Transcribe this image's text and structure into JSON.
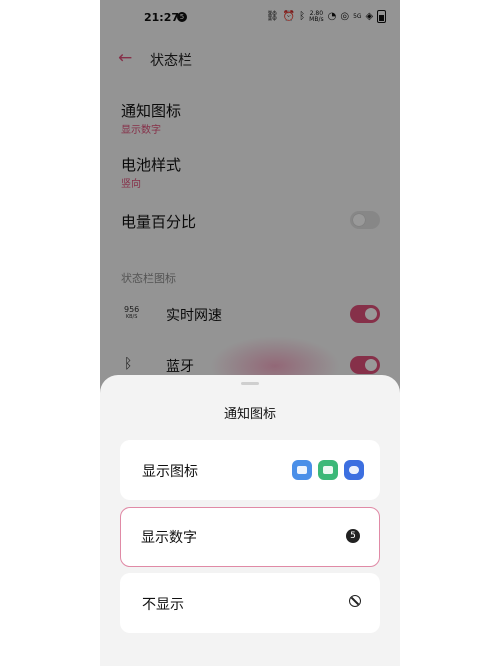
{
  "status_bar": {
    "time": "21:27",
    "notification_badge": "5",
    "net_speed_value": "2.80",
    "net_speed_unit": "MB/s",
    "signal_label": "5G"
  },
  "header": {
    "title": "状态栏"
  },
  "settings": {
    "notification_icon": {
      "title": "通知图标",
      "value": "显示数字"
    },
    "battery_style": {
      "title": "电池样式",
      "value": "竖向"
    },
    "battery_percentage": {
      "title": "电量百分比",
      "enabled": false
    },
    "section_title": "状态栏图标",
    "net_speed": {
      "icon_value": "956",
      "icon_unit": "KB/S",
      "label": "实时网速",
      "enabled": true
    },
    "bluetooth": {
      "label": "蓝牙",
      "enabled": true
    }
  },
  "sheet": {
    "title": "通知图标",
    "options": [
      {
        "label": "显示图标",
        "icons": [
          "mail-icon",
          "message-icon",
          "chat-icon"
        ]
      },
      {
        "label": "显示数字",
        "badge": "5",
        "selected": true
      },
      {
        "label": "不显示",
        "icon": "no-icon"
      }
    ]
  },
  "colors": {
    "accent": "#e0507a",
    "selected_border": "#e08aa6"
  }
}
